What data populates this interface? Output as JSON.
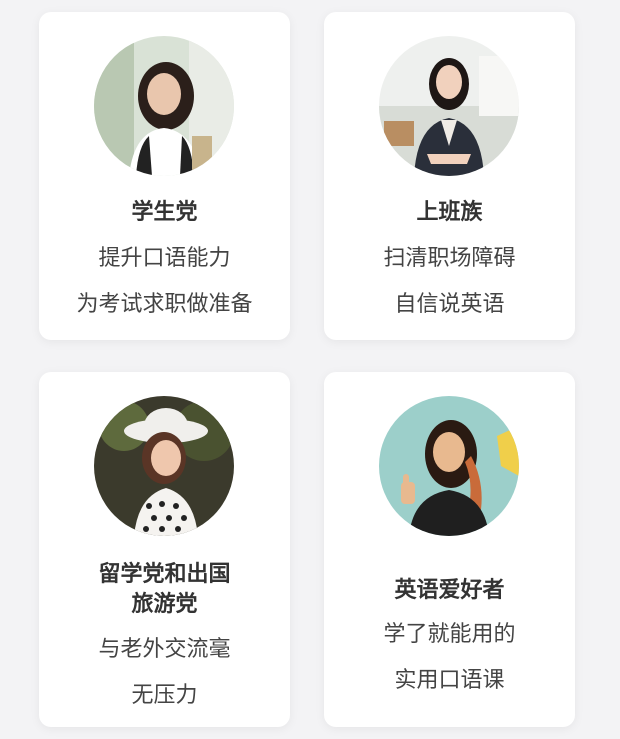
{
  "cards": [
    {
      "title": "学生党",
      "line1": "提升口语能力",
      "line2": "为考试求职做准备",
      "avatar": "student-photo"
    },
    {
      "title": "上班族",
      "line1": "扫清职场障碍",
      "line2": "自信说英语",
      "avatar": "office-worker-photo"
    },
    {
      "title_lines": [
        "留学党和出国",
        "旅游党"
      ],
      "line1": "与老外交流毫",
      "line2": "无压力",
      "avatar": "traveler-photo"
    },
    {
      "title": "英语爱好者",
      "line1": "学了就能用的",
      "line2": "实用口语课",
      "avatar": "enthusiast-photo"
    }
  ]
}
